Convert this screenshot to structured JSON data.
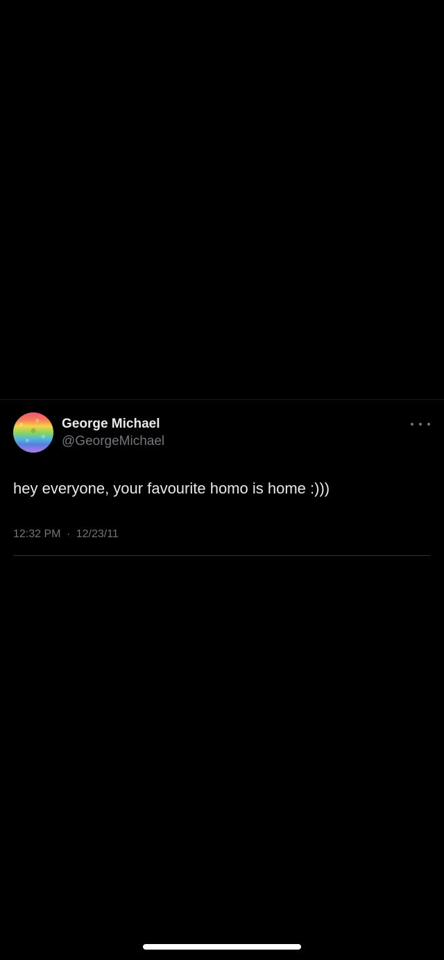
{
  "tweet": {
    "display_name": "George Michael",
    "handle": "@GeorgeMichael",
    "text": "hey everyone, your favourite homo is home :)))",
    "time": "12:32 PM",
    "separator": "·",
    "date": "12/23/11"
  },
  "icons": {
    "more": "more-horizontal-icon",
    "avatar": "rainbow-avatar"
  },
  "colors": {
    "background": "#000000",
    "primary_text": "#e7e9ea",
    "secondary_text": "#71767b",
    "divider": "#2f3336"
  }
}
